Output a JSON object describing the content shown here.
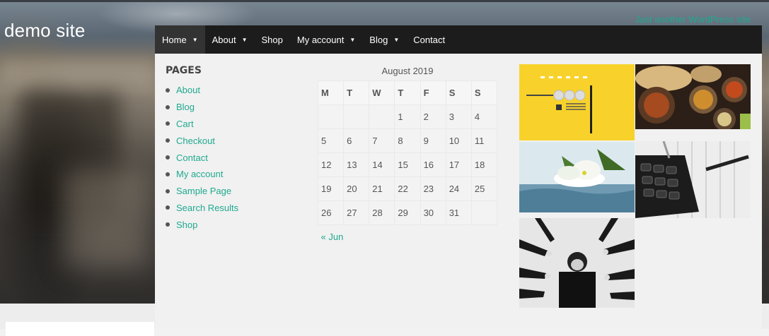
{
  "site": {
    "title": "demo site",
    "tagline": "Just another WordPress site"
  },
  "nav": {
    "items": [
      {
        "label": "Home",
        "has_dropdown": true,
        "active": true
      },
      {
        "label": "About",
        "has_dropdown": true
      },
      {
        "label": "Shop",
        "has_dropdown": false
      },
      {
        "label": "My account",
        "has_dropdown": true
      },
      {
        "label": "Blog",
        "has_dropdown": true
      },
      {
        "label": "Contact",
        "has_dropdown": false
      }
    ],
    "caret": "▼"
  },
  "pages_widget": {
    "title": "PAGES",
    "items": [
      "About",
      "Blog",
      "Cart",
      "Checkout",
      "Contact",
      "My account",
      "Sample Page",
      "Search Results",
      "Shop"
    ]
  },
  "calendar": {
    "caption": "August 2019",
    "days": [
      "M",
      "T",
      "W",
      "T",
      "F",
      "S",
      "S"
    ],
    "weeks": [
      [
        "",
        "",
        "",
        "1",
        "2",
        "3",
        "4"
      ],
      [
        "5",
        "6",
        "7",
        "8",
        "9",
        "10",
        "11"
      ],
      [
        "12",
        "13",
        "14",
        "15",
        "16",
        "17",
        "18"
      ],
      [
        "19",
        "20",
        "21",
        "22",
        "23",
        "24",
        "25"
      ],
      [
        "26",
        "27",
        "28",
        "29",
        "30",
        "31",
        ""
      ]
    ],
    "prev_link": "« Jun"
  },
  "colors": {
    "accent": "#1fa98f",
    "nav_bg": "#1c1c1c"
  }
}
